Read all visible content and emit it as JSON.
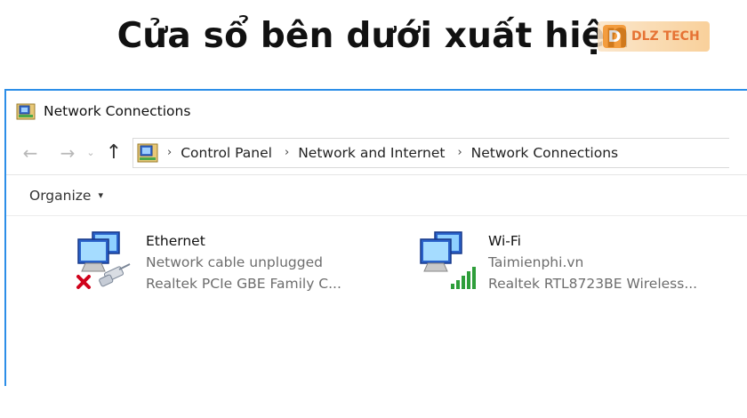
{
  "caption": "Cửa sổ bên dưới xuất hiện",
  "logo": {
    "mark": "D",
    "text": "DLZ TECH"
  },
  "window": {
    "title": "Network Connections",
    "nav": {
      "back_icon": "←",
      "forward_icon": "→",
      "recent_icon": "⌄",
      "up_icon": "↑",
      "separator": "›",
      "breadcrumbs": [
        "Control Panel",
        "Network and Internet",
        "Network Connections"
      ]
    },
    "toolbar": {
      "organize_label": "Organize",
      "caret": "▾"
    },
    "connections": [
      {
        "name": "Ethernet",
        "status": "Network cable unplugged",
        "device": "Realtek PCIe GBE Family C...",
        "icon": "ethernet-disconnected-icon"
      },
      {
        "name": "Wi-Fi",
        "status": "Taimienphi.vn",
        "device": "Realtek RTL8723BE Wireless...",
        "icon": "wifi-connected-icon"
      }
    ]
  },
  "colors": {
    "window_border": "#2c8ee8",
    "error_red": "#d0021b",
    "signal_green": "#2e9e3a",
    "logo_orange": "#f28c1e"
  }
}
